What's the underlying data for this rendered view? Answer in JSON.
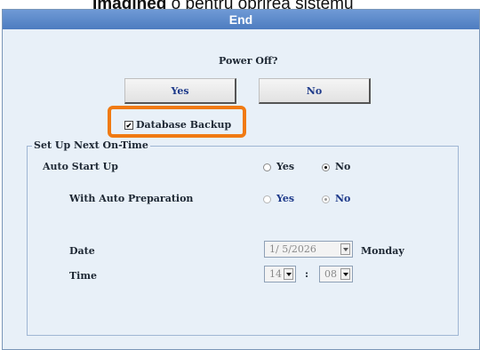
{
  "header_text": {
    "bold": "Imagined",
    "rest": " ó pentru oprirea sistemu"
  },
  "dialog": {
    "title": "End",
    "question": "Power Off?",
    "yes_label": "Yes",
    "no_label": "No",
    "backup": {
      "label": "Database Backup",
      "checked": true
    }
  },
  "next_on_time": {
    "legend": "Set Up Next On-Time",
    "auto_start": {
      "label": "Auto Start Up",
      "yes": "Yes",
      "no": "No",
      "selected": "No"
    },
    "auto_prep": {
      "label": "With Auto Preparation",
      "yes": "Yes",
      "no": "No",
      "selected": "No",
      "enabled": false
    },
    "date": {
      "label": "Date",
      "value": "1/ 5/2026",
      "weekday": "Monday"
    },
    "time": {
      "label": "Time",
      "hour": "14",
      "separator": ":",
      "minute": "08"
    }
  },
  "colors": {
    "titlebar": "#5a88cc",
    "highlight": "#f07a12",
    "window_bg": "#e8f0f8",
    "button_text": "#1e3a8a"
  }
}
